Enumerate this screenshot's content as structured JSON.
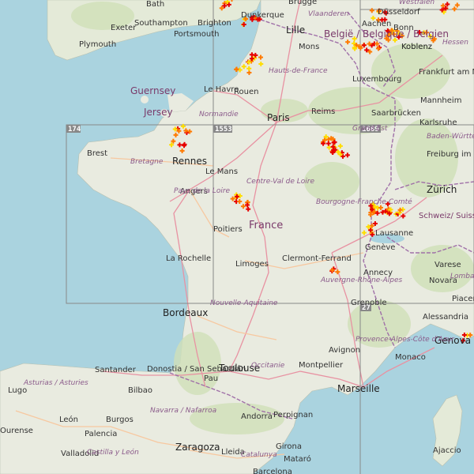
{
  "map": {
    "grid_labels": [
      "174",
      "1553",
      "1689",
      "27"
    ],
    "cities": [
      {
        "name": "Bath"
      },
      {
        "name": "Brighton"
      },
      {
        "name": "Dunkerque"
      },
      {
        "name": "Brugge"
      },
      {
        "name": "Düsseldorf"
      },
      {
        "name": "Exeter"
      },
      {
        "name": "Southampton"
      },
      {
        "name": "Portsmouth"
      },
      {
        "name": "Plymouth"
      },
      {
        "name": "Lille"
      },
      {
        "name": "Mons"
      },
      {
        "name": "Aachen"
      },
      {
        "name": "Bonn"
      },
      {
        "name": "Koblenz"
      },
      {
        "name": "Frankfurt am Main"
      },
      {
        "name": "Le Havre"
      },
      {
        "name": "Rouen"
      },
      {
        "name": "Paris"
      },
      {
        "name": "Reims"
      },
      {
        "name": "Luxembourg"
      },
      {
        "name": "Saarbrücken"
      },
      {
        "name": "Mannheim"
      },
      {
        "name": "Karlsruhe"
      },
      {
        "name": "Brest"
      },
      {
        "name": "Rennes"
      },
      {
        "name": "Le Mans"
      },
      {
        "name": "Angers"
      },
      {
        "name": "Freiburg im Breisgau"
      },
      {
        "name": "Zürich"
      },
      {
        "name": "Lausanne"
      },
      {
        "name": "Genève"
      },
      {
        "name": "Poitiers"
      },
      {
        "name": "La Rochelle"
      },
      {
        "name": "Limoges"
      },
      {
        "name": "Clermont-Ferrand"
      },
      {
        "name": "Annecy"
      },
      {
        "name": "Varese"
      },
      {
        "name": "Novara"
      },
      {
        "name": "Piacenza"
      },
      {
        "name": "Bordeaux"
      },
      {
        "name": "Grenoble"
      },
      {
        "name": "Alessandria"
      },
      {
        "name": "Avignon"
      },
      {
        "name": "Monaco"
      },
      {
        "name": "Genova"
      },
      {
        "name": "Santander"
      },
      {
        "name": "Donostia / San Sebastián"
      },
      {
        "name": "Toulouse"
      },
      {
        "name": "Montpellier"
      },
      {
        "name": "Marseille"
      },
      {
        "name": "Pau"
      },
      {
        "name": "Lugo"
      },
      {
        "name": "Bilbao"
      },
      {
        "name": "León"
      },
      {
        "name": "Burgos"
      },
      {
        "name": "Andorra"
      },
      {
        "name": "Perpignan"
      },
      {
        "name": "Palencia"
      },
      {
        "name": "Valladolid"
      },
      {
        "name": "Zaragoza"
      },
      {
        "name": "Lleida"
      },
      {
        "name": "Girona"
      },
      {
        "name": "Mataró"
      },
      {
        "name": "Barcelona"
      },
      {
        "name": "Ajaccio"
      },
      {
        "name": "Ourense"
      },
      {
        "name": "Koblenz"
      }
    ],
    "regions": [
      "Vlaanderen",
      "Hauts-de-France",
      "Normandie",
      "Bretagne",
      "Pays de la Loire",
      "Centre-Val de Loire",
      "Grand Est",
      "Bourgogne-Franche-Comté",
      "Baden-Württemberg",
      "Nouvelle-Aquitaine",
      "Auvergne-Rhône-Alpes",
      "Occitanie",
      "Provence-Alpes-Côte d'Azur",
      "Asturias / Asturies",
      "Castilla y León",
      "Navarra / Nafarroa",
      "Catalunya",
      "Lombardia",
      "Hessen",
      "Westfalen"
    ],
    "countries": [
      {
        "name": "België / Belgique / Belgien"
      },
      {
        "name": "France"
      },
      {
        "name": "Schweiz/ Suisse/Svizzera/ Svizra"
      },
      {
        "name": "Guernsey"
      },
      {
        "name": "Jersey"
      }
    ],
    "colors": {
      "sea": "#aad3df",
      "land": "#e9ebe0",
      "forest": "#cfe0b8",
      "road_major": "#e892a2",
      "road_minor": "#f7c8a0",
      "border": "#a070a8",
      "lightning_red": "#e60000",
      "lightning_orange": "#ff7a00",
      "lightning_yellow": "#ffdd00",
      "grid": "#888888"
    },
    "legend": {
      "lightning_icon": "plus-marker-icon",
      "lightning_meaning": "Lightning strike markers"
    }
  }
}
